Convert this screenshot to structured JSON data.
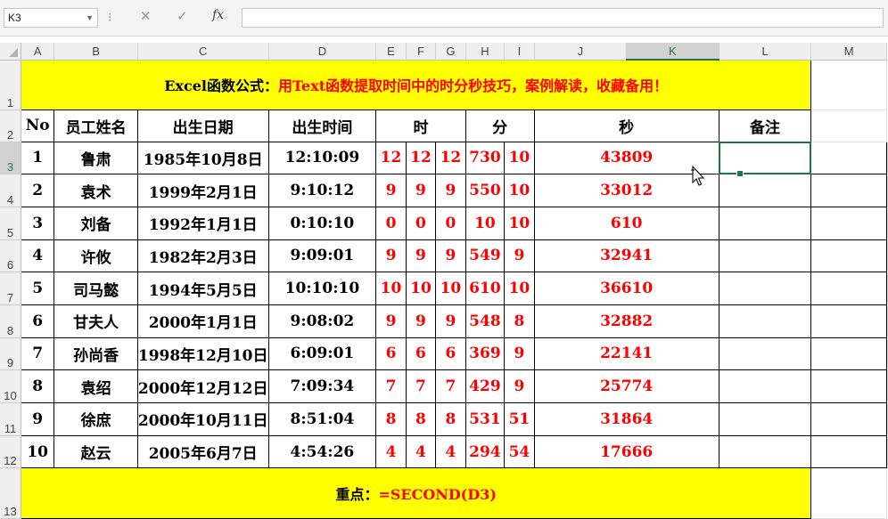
{
  "formula_bar": {
    "name_box": "K3",
    "fx_label": "fx",
    "formula": ""
  },
  "columns": [
    "A",
    "B",
    "C",
    "D",
    "E",
    "F",
    "G",
    "H",
    "I",
    "J",
    "K",
    "L",
    "M"
  ],
  "row_numbers": [
    "1",
    "2",
    "3",
    "4",
    "5",
    "6",
    "7",
    "8",
    "9",
    "10",
    "11",
    "12",
    "13"
  ],
  "title": {
    "black": "Excel函数公式：",
    "red": "用Text函数提取时间中的时分秒技巧，案例解读，收藏备用！"
  },
  "headers": {
    "no": "No",
    "name": "员工姓名",
    "birth_date": "出生日期",
    "birth_time": "出生时间",
    "hour": "时",
    "minute": "分",
    "second": "秒",
    "note": "备注"
  },
  "rows": [
    {
      "no": "1",
      "name": "鲁肃",
      "date": "1985年10月8日",
      "time": "12:10:09",
      "e": "12",
      "f": "12",
      "g": "12",
      "h": "730",
      "i": "10",
      "j": "43809"
    },
    {
      "no": "2",
      "name": "袁术",
      "date": "1999年2月1日",
      "time": "9:10:12",
      "e": "9",
      "f": "9",
      "g": "9",
      "h": "550",
      "i": "10",
      "j": "33012"
    },
    {
      "no": "3",
      "name": "刘备",
      "date": "1992年1月1日",
      "time": "0:10:10",
      "e": "0",
      "f": "0",
      "g": "0",
      "h": "10",
      "i": "10",
      "j": "610"
    },
    {
      "no": "4",
      "name": "许攸",
      "date": "1982年2月3日",
      "time": "9:09:01",
      "e": "9",
      "f": "9",
      "g": "9",
      "h": "549",
      "i": "9",
      "j": "32941"
    },
    {
      "no": "5",
      "name": "司马懿",
      "date": "1994年5月5日",
      "time": "10:10:10",
      "e": "10",
      "f": "10",
      "g": "10",
      "h": "610",
      "i": "10",
      "j": "36610"
    },
    {
      "no": "6",
      "name": "甘夫人",
      "date": "2000年1月1日",
      "time": "9:08:02",
      "e": "9",
      "f": "9",
      "g": "9",
      "h": "548",
      "i": "8",
      "j": "32882"
    },
    {
      "no": "7",
      "name": "孙尚香",
      "date": "1998年12月10日",
      "time": "6:09:01",
      "e": "6",
      "f": "6",
      "g": "6",
      "h": "369",
      "i": "9",
      "j": "22141"
    },
    {
      "no": "8",
      "name": "袁绍",
      "date": "2000年12月12日",
      "time": "7:09:34",
      "e": "7",
      "f": "7",
      "g": "7",
      "h": "429",
      "i": "9",
      "j": "25774"
    },
    {
      "no": "9",
      "name": "徐庶",
      "date": "2000年10月11日",
      "time": "8:51:04",
      "e": "8",
      "f": "8",
      "g": "8",
      "h": "531",
      "i": "51",
      "j": "31864"
    },
    {
      "no": "10",
      "name": "赵云",
      "date": "2005年6月7日",
      "time": "4:54:26",
      "e": "4",
      "f": "4",
      "g": "4",
      "h": "294",
      "i": "54",
      "j": "17666"
    }
  ],
  "footer": {
    "black": "重点：",
    "red": "=SECOND(D3)"
  },
  "colors": {
    "highlight": "#ffff00",
    "accent_red": "#ff0000",
    "excel_green": "#217346"
  }
}
